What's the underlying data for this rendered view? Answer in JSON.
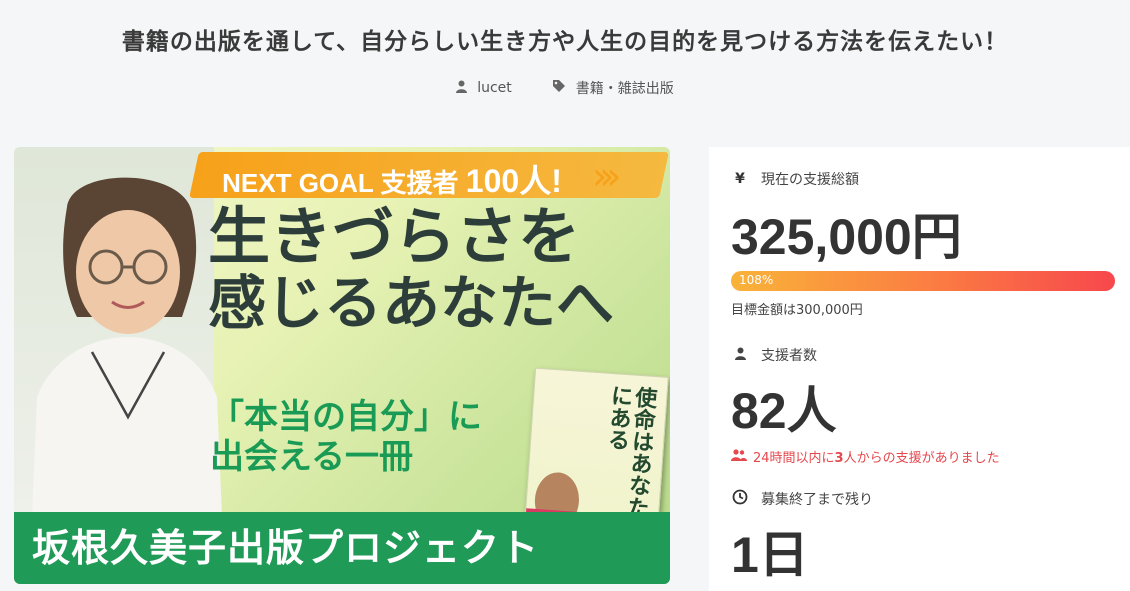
{
  "page": {
    "title": "書籍の出版を通して、自分らしい生き方や人生の目的を見つける方法を伝えたい！",
    "owner": "lucet",
    "category": "書籍・雑誌出版"
  },
  "hero": {
    "goal_prefix": "NEXT GOAL 支援者",
    "goal_number": "100人!",
    "headline_1": "生きづらさを",
    "headline_2": "感じるあなたへ",
    "sub_1": "「本当の自分」に",
    "sub_2": "出会える一冊",
    "book_title": "使命はあなたの中にある",
    "project": "坂根久美子出版プロジェクト"
  },
  "stats": {
    "amount_label": "現在の支援総額",
    "amount": "325,000円",
    "progress_percent": 108,
    "progress_label": "108%",
    "goal_text": "目標金額は300,000円",
    "backers_label": "支援者数",
    "backers": "82人",
    "recent_prefix": "24時間以内に",
    "recent_count": "3",
    "recent_suffix": "人からの支援がありました",
    "remain_label": "募集終了まで残り",
    "remain": "1日"
  },
  "icons": {
    "owner": "user-icon",
    "category": "tag-icon",
    "amount": "yen-icon",
    "backers": "user-icon",
    "recent": "users-icon",
    "remain": "clock-icon"
  },
  "colors": {
    "accent_green": "#1f9a57",
    "accent_red": "#e5484d",
    "progress_start": "#f9b339",
    "progress_end": "#f7474d"
  }
}
